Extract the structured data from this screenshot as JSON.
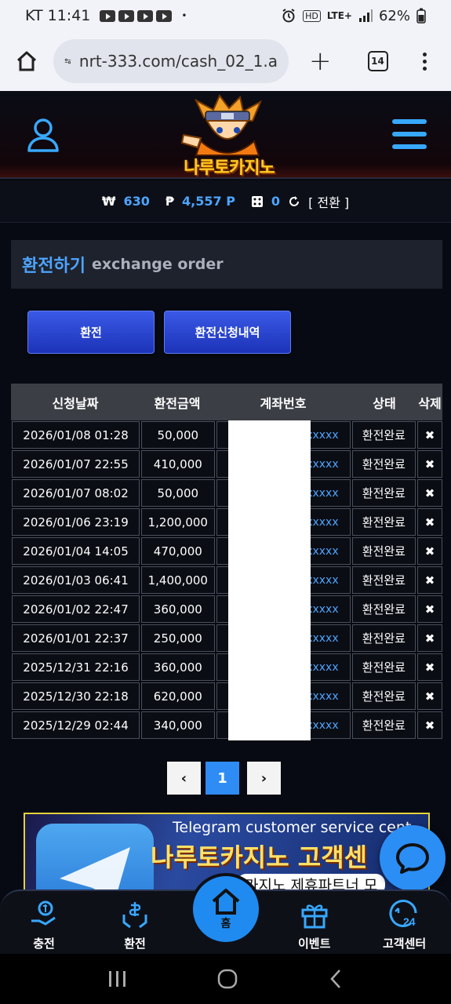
{
  "status_bar": {
    "carrier_time": "KT 11:41",
    "dot": "•",
    "network": "LTE+",
    "hd": "HD",
    "battery": "62%"
  },
  "browser": {
    "url": "nrt-333.com/cash_02_1.a",
    "tab_count": "14"
  },
  "site": {
    "logo_text": "나루토카지노",
    "balance": {
      "won_symbol": "₩",
      "won_value": "630",
      "point_symbol": "₱",
      "point_value": "4,557 P",
      "chip_value": "0",
      "convert_label": "[ 전환 ]"
    }
  },
  "page": {
    "title_ko": "환전하기",
    "title_en": "exchange order",
    "buttons": {
      "exchange": "환전",
      "history": "환전신청내역"
    }
  },
  "table": {
    "headers": [
      "신청날짜",
      "환전금액",
      "계좌번호",
      "상태",
      "삭제"
    ],
    "rows": [
      {
        "date": "2026/01/08 01:28",
        "amount": "50,000",
        "account": "xxxxx",
        "status": "환전완료",
        "del": "✖"
      },
      {
        "date": "2026/01/07 22:55",
        "amount": "410,000",
        "account": "xxxxx",
        "status": "환전완료",
        "del": "✖"
      },
      {
        "date": "2026/01/07 08:02",
        "amount": "50,000",
        "account": "xxxxx",
        "status": "환전완료",
        "del": "✖"
      },
      {
        "date": "2026/01/06 23:19",
        "amount": "1,200,000",
        "account": "xxxxx",
        "status": "환전완료",
        "del": "✖"
      },
      {
        "date": "2026/01/04 14:05",
        "amount": "470,000",
        "account": "xxxxx",
        "status": "환전완료",
        "del": "✖"
      },
      {
        "date": "2026/01/03 06:41",
        "amount": "1,400,000",
        "account": "xxxxx",
        "status": "환전완료",
        "del": "✖"
      },
      {
        "date": "2026/01/02 22:47",
        "amount": "360,000",
        "account": "xxxxx",
        "status": "환전완료",
        "del": "✖"
      },
      {
        "date": "2026/01/01 22:37",
        "amount": "250,000",
        "account": "xxxxx",
        "status": "환전완료",
        "del": "✖"
      },
      {
        "date": "2025/12/31 22:16",
        "amount": "360,000",
        "account": "xxxxx",
        "status": "환전완료",
        "del": "✖"
      },
      {
        "date": "2025/12/30 22:18",
        "amount": "620,000",
        "account": "xxxxx",
        "status": "환전완료",
        "del": "✖"
      },
      {
        "date": "2025/12/29 02:44",
        "amount": "340,000",
        "account": "xxxxx",
        "status": "환전완료",
        "del": "✖"
      }
    ]
  },
  "pagination": {
    "prev": "‹",
    "current": "1",
    "next": "›"
  },
  "banner": {
    "line1": "Telegram customer service cent",
    "line2": "나루토카지노 고객센",
    "line3": "카지노 제휴파트너 모"
  },
  "bottom_nav": {
    "charge": "충전",
    "exchange": "환전",
    "home": "홈",
    "event": "이벤트",
    "support": "고객센터"
  }
}
